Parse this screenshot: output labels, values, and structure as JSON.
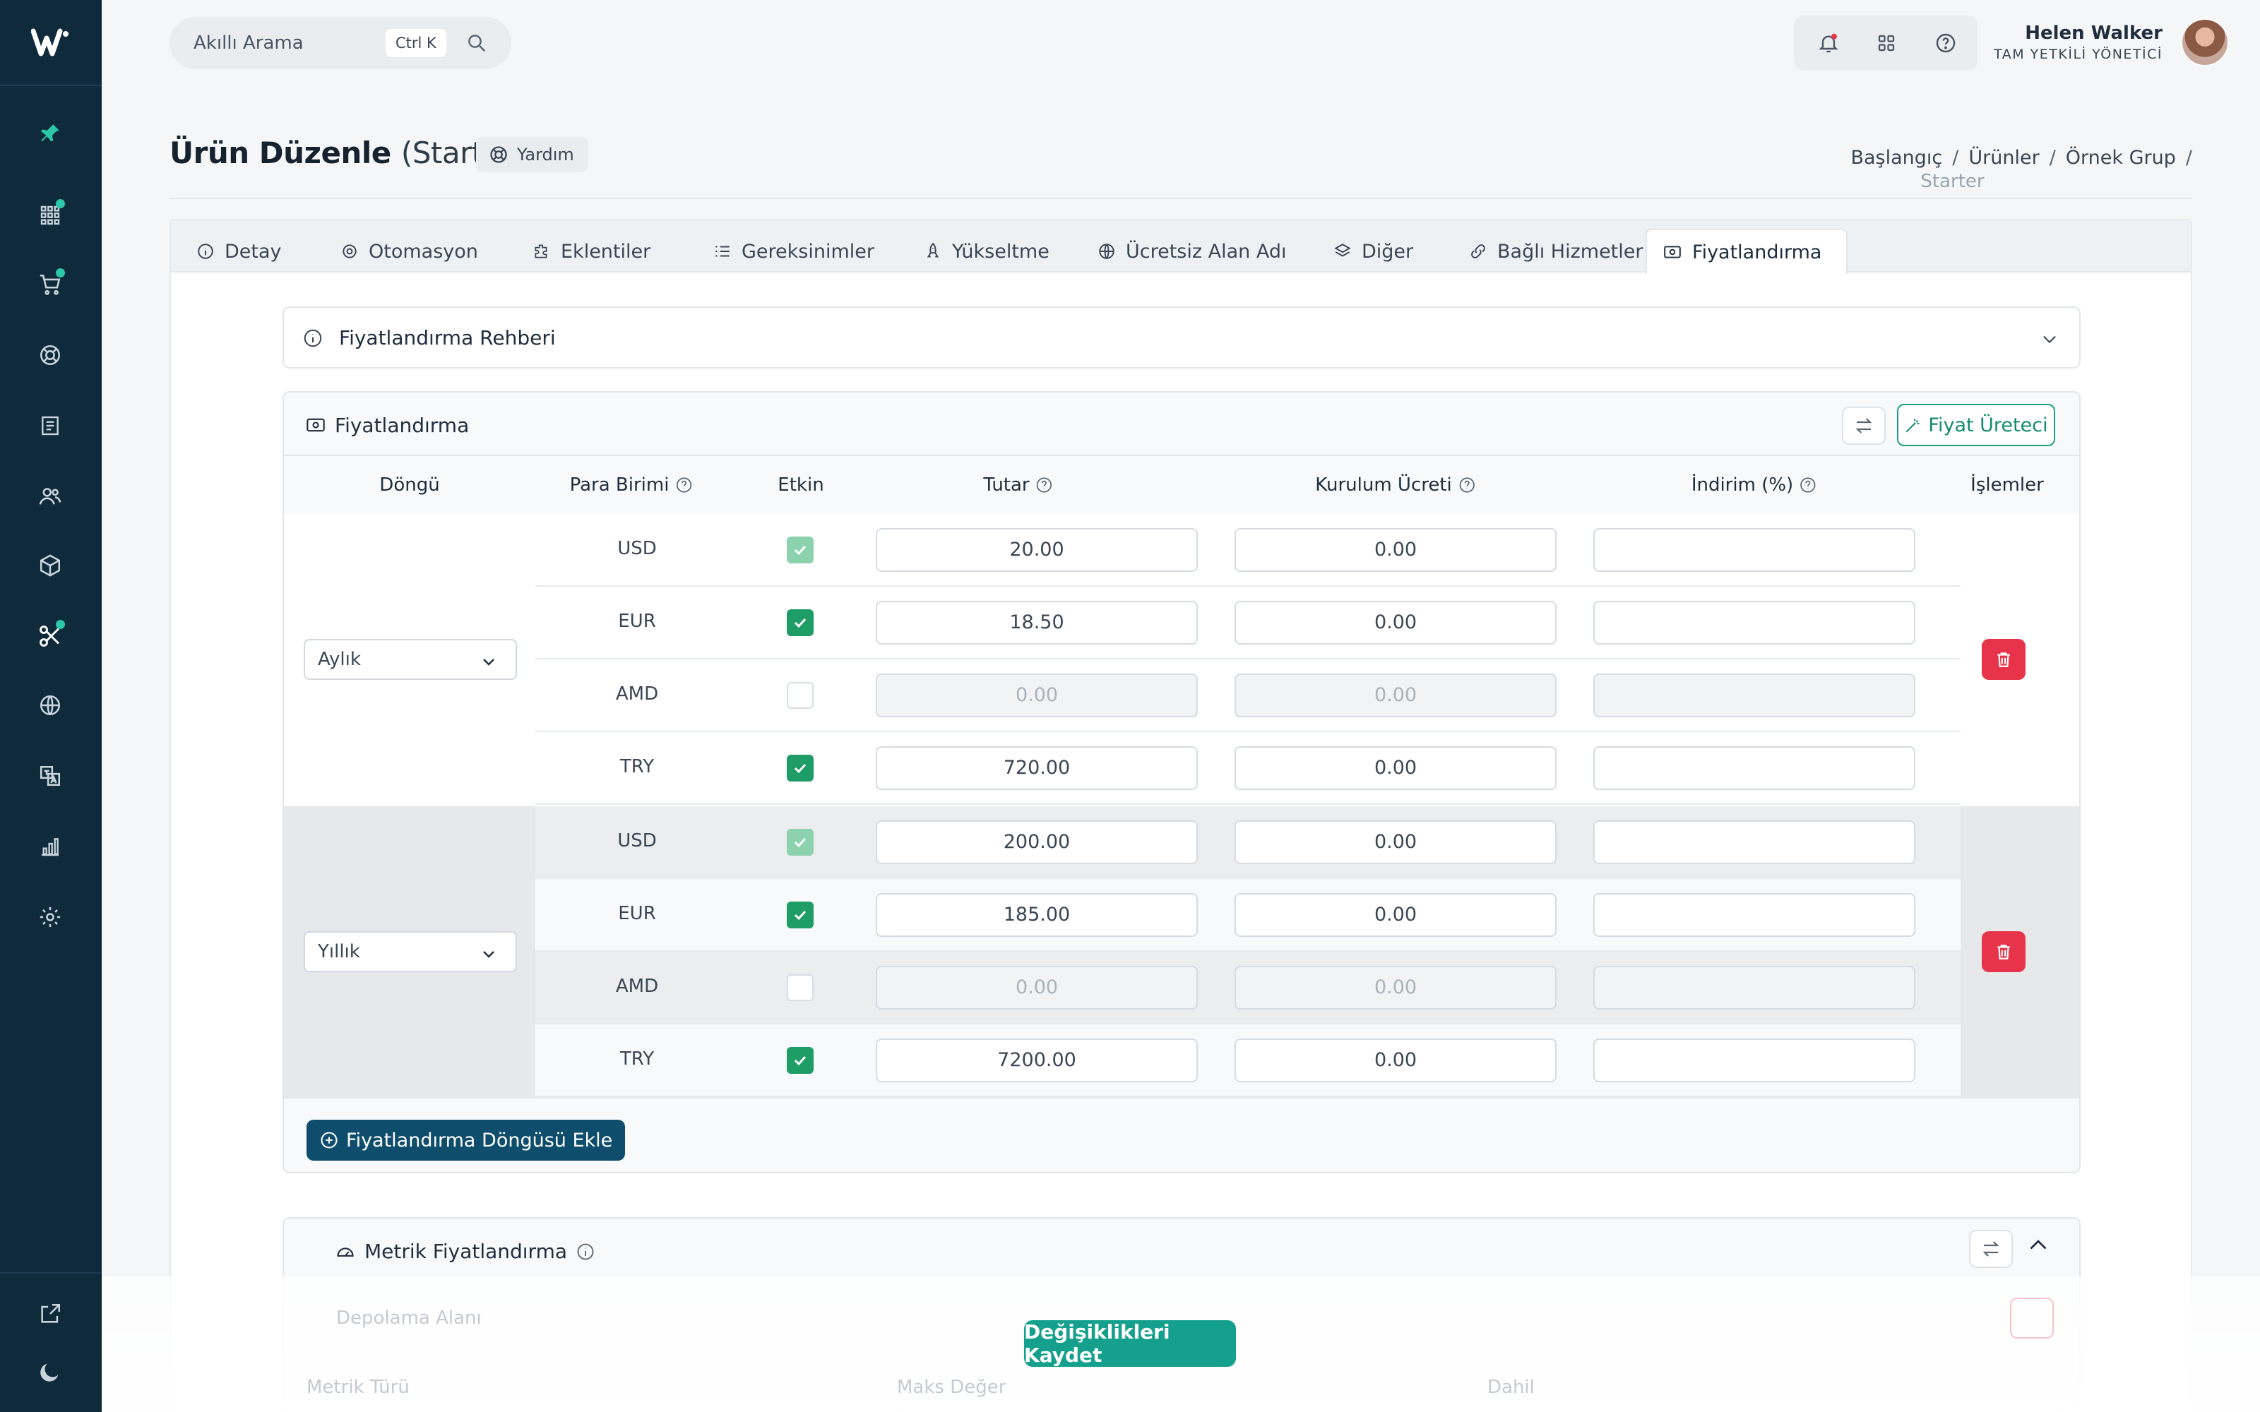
{
  "app": {
    "brand": "W"
  },
  "search": {
    "placeholder": "Akıllı Arama",
    "shortcut": "Ctrl K"
  },
  "user": {
    "name": "Helen Walker",
    "role": "TAM YETKİLİ YÖNETİCİ"
  },
  "page": {
    "title": "Ürün Düzenle",
    "subtitle": "(Starter)",
    "help_label": "Yardım"
  },
  "breadcrumb": [
    {
      "label": "Başlangıç"
    },
    {
      "label": "Ürünler"
    },
    {
      "label": "Örnek Grup"
    },
    {
      "label": "Starter"
    }
  ],
  "tabs": [
    {
      "label": "Detay",
      "icon": "info-icon"
    },
    {
      "label": "Otomasyon",
      "icon": "gear-icon"
    },
    {
      "label": "Eklentiler",
      "icon": "puzzle-icon"
    },
    {
      "label": "Gereksinimler",
      "icon": "list-icon"
    },
    {
      "label": "Yükseltme",
      "icon": "rocket-icon"
    },
    {
      "label": "Ücretsiz Alan Adı",
      "icon": "globe-icon"
    },
    {
      "label": "Diğer",
      "icon": "layers-icon"
    },
    {
      "label": "Bağlı Hizmetler",
      "icon": "link-icon"
    },
    {
      "label": "Fiyatlandırma",
      "icon": "money-icon",
      "active": true
    }
  ],
  "guide": {
    "label": "Fiyatlandırma Rehberi"
  },
  "pricing": {
    "label": "Fiyatlandırma",
    "generator_label": "Fiyat Üreteci",
    "columns": {
      "cycle": "Döngü",
      "currency": "Para Birimi",
      "enabled": "Etkin",
      "amount": "Tutar",
      "setup_fee": "Kurulum Ücreti",
      "discount": "İndirim (%)",
      "actions": "İşlemler"
    },
    "cycles": [
      {
        "cycle": "Aylık",
        "rows": [
          {
            "currency": "USD",
            "enabled": "default",
            "amount": "20.00",
            "setup_fee": "0.00",
            "discount": ""
          },
          {
            "currency": "EUR",
            "enabled": "on",
            "amount": "18.50",
            "setup_fee": "0.00",
            "discount": ""
          },
          {
            "currency": "AMD",
            "enabled": "off",
            "amount": "0.00",
            "setup_fee": "0.00",
            "discount": ""
          },
          {
            "currency": "TRY",
            "enabled": "on",
            "amount": "720.00",
            "setup_fee": "0.00",
            "discount": ""
          }
        ]
      },
      {
        "cycle": "Yıllık",
        "rows": [
          {
            "currency": "USD",
            "enabled": "default",
            "amount": "200.00",
            "setup_fee": "0.00",
            "discount": ""
          },
          {
            "currency": "EUR",
            "enabled": "on",
            "amount": "185.00",
            "setup_fee": "0.00",
            "discount": ""
          },
          {
            "currency": "AMD",
            "enabled": "off",
            "amount": "0.00",
            "setup_fee": "0.00",
            "discount": ""
          },
          {
            "currency": "TRY",
            "enabled": "on",
            "amount": "7200.00",
            "setup_fee": "0.00",
            "discount": ""
          }
        ]
      }
    ],
    "add_cycle_label": "Fiyatlandırma Döngüsü Ekle"
  },
  "metric": {
    "label": "Metrik Fiyatlandırma",
    "item": "Depolama Alanı",
    "metric_type": "Metrik Türü",
    "max_value": "Maks Değer",
    "included": "Dahil"
  },
  "save_label": "Değişiklikleri Kaydet",
  "colors": {
    "sidebar": "#0e2a3b",
    "accent": "#14a08c",
    "primary": "#0e4d6b",
    "danger": "#e8344a",
    "check": "#1f9d67"
  }
}
